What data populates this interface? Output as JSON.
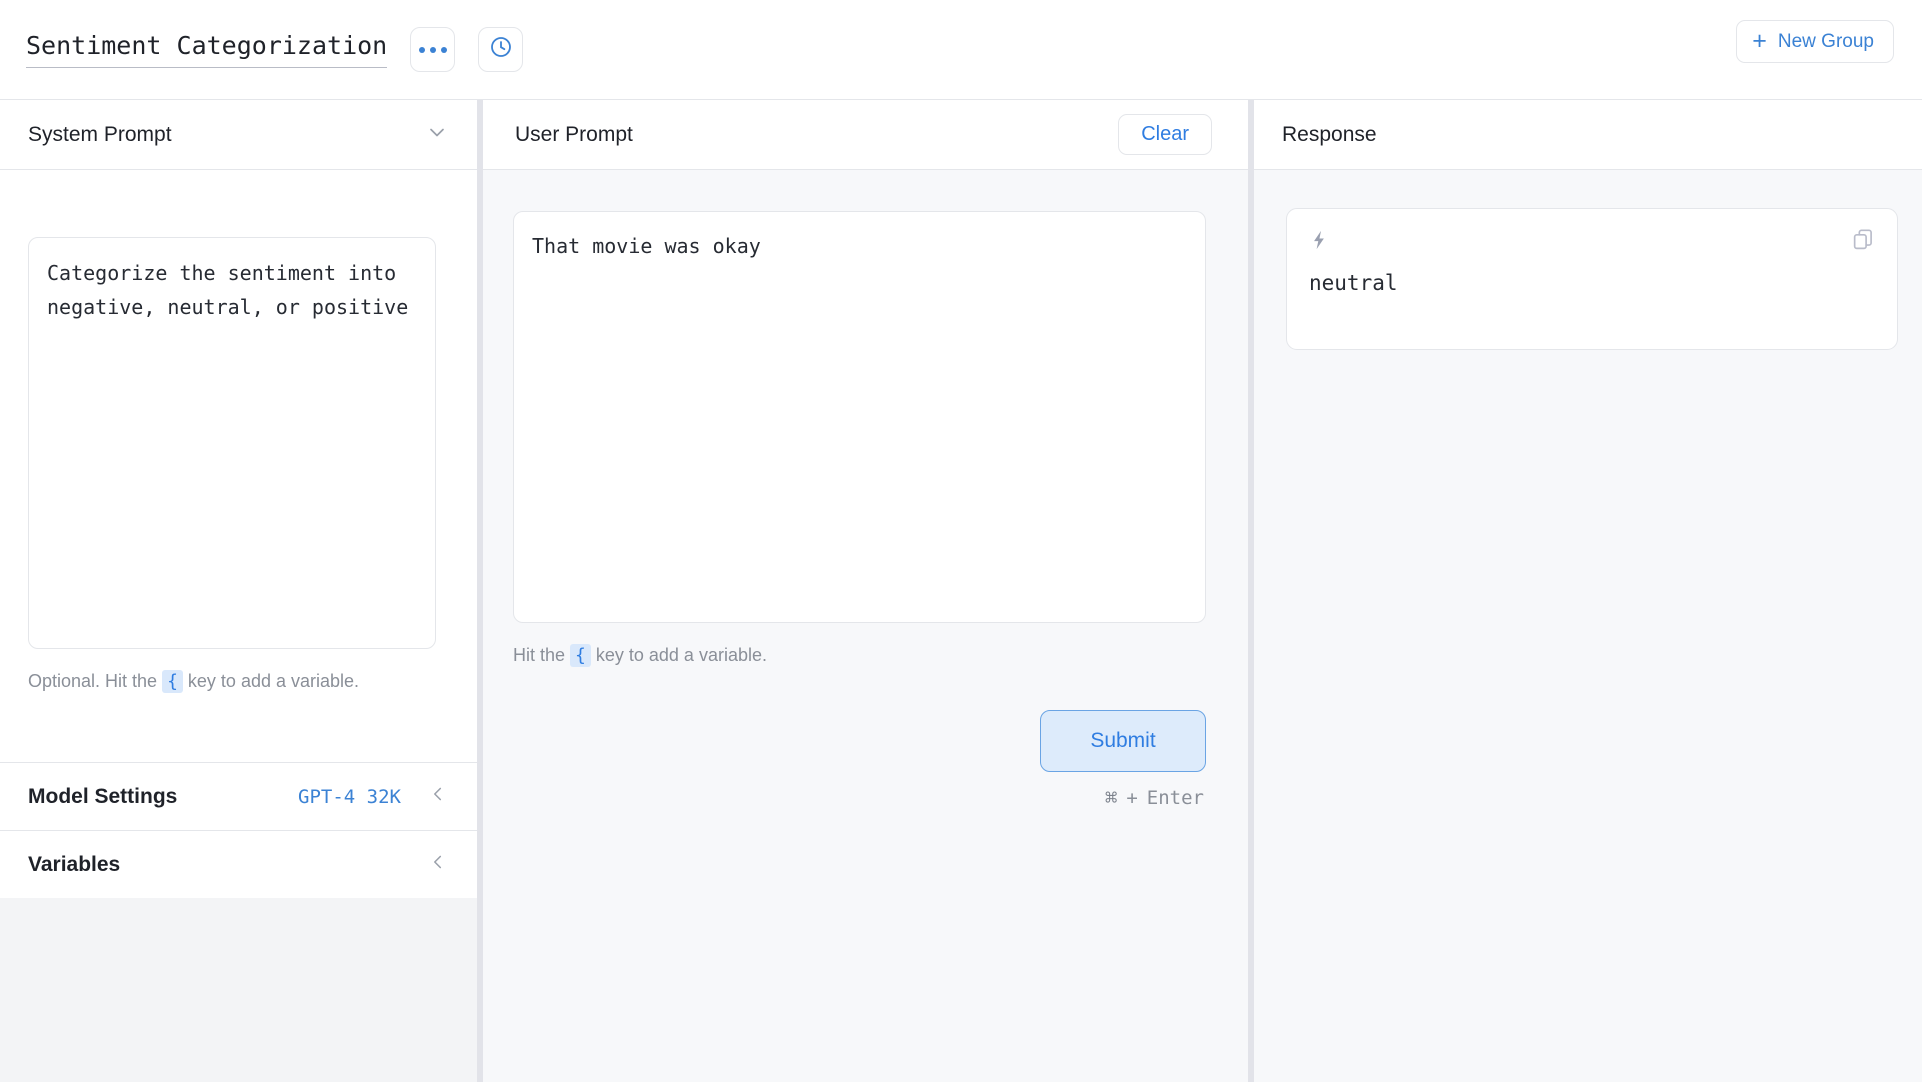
{
  "topbar": {
    "doc_title": "Sentiment Categorization",
    "more_button_icon": "ellipsis-icon",
    "history_button_icon": "clock-icon",
    "new_group_label": "New Group",
    "new_group_plus": "+"
  },
  "system_panel": {
    "title": "System Prompt",
    "collapse_icon": "chevron-down-icon",
    "prompt_value": "Categorize the sentiment into negative, neutral, or positive",
    "prompt_placeholder": "Optional. Hit the { key to add a variable.",
    "hint_prefix": "Optional. Hit the",
    "hint_brace": "{",
    "hint_suffix": "key to add a variable."
  },
  "model_settings": {
    "label": "Model Settings",
    "value": "GPT-4 32K",
    "collapse_icon": "chevron-left-icon"
  },
  "variables": {
    "label": "Variables",
    "collapse_icon": "chevron-left-icon"
  },
  "user_panel": {
    "title": "User Prompt",
    "clear_label": "Clear",
    "prompt_value": "That movie was okay",
    "prompt_placeholder": "Hit the { key to add a variable.",
    "hint_prefix": "Hit the",
    "hint_brace": "{",
    "hint_suffix": "key to add a variable.",
    "submit_label": "Submit",
    "shortcut_cmd": "⌘",
    "shortcut_plus": "+",
    "shortcut_key": "Enter"
  },
  "response_panel": {
    "title": "Response",
    "bolt_icon": "lightning-bolt-icon",
    "copy_icon": "copy-icon",
    "response_text": "neutral"
  },
  "colors": {
    "accent_blue": "#3b82d4",
    "link_blue": "#2f7de1",
    "submit_bg": "#ddebfb",
    "panel_bg": "#f7f8fa",
    "left_bg": "#f3f4f6",
    "border": "#e4e6ea",
    "text": "#1f2229",
    "muted": "#8a8f98"
  }
}
